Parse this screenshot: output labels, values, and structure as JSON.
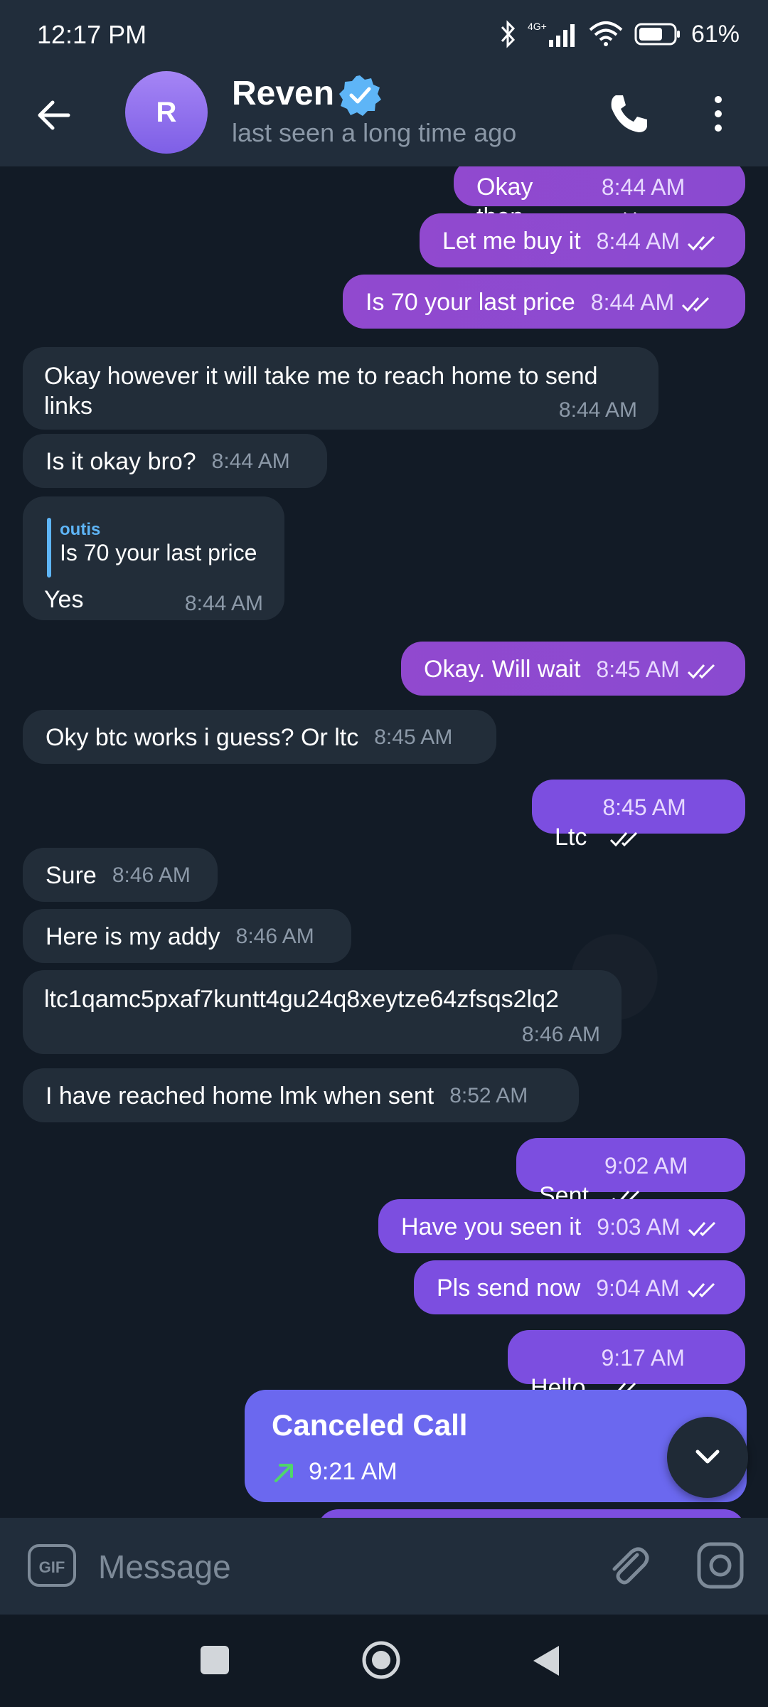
{
  "status_bar": {
    "time": "12:17 PM",
    "network": "4G+",
    "battery": "61%"
  },
  "header": {
    "avatar_letter": "R",
    "name": "Reven",
    "status": "last seen a long time ago"
  },
  "messages": [
    {
      "text": "Okay then",
      "time": "8:44 AM"
    },
    {
      "text": "Let me buy it",
      "time": "8:44 AM"
    },
    {
      "text": "Is 70 your last price",
      "time": "8:44 AM"
    },
    {
      "text": "Okay however it will take me to reach home to send links",
      "time": "8:44 AM"
    },
    {
      "text": "Is it okay bro?",
      "time": "8:44 AM"
    },
    {
      "reply_name": "outis",
      "reply_text": "Is 70 your last price",
      "text": "Yes",
      "time": "8:44 AM"
    },
    {
      "text": "Okay. Will wait",
      "time": "8:45 AM"
    },
    {
      "text": "Oky btc works i guess? Or ltc",
      "time": "8:45 AM"
    },
    {
      "text": "Ltc",
      "time": "8:45 AM"
    },
    {
      "text": "Sure",
      "time": "8:46 AM"
    },
    {
      "text": "Here is my addy",
      "time": "8:46 AM"
    },
    {
      "text": "ltc1qamc5pxaf7kuntt4gu24q8xeytze64zfsqs2lq2",
      "time": "8:46 AM"
    },
    {
      "text": "I have reached home lmk when sent",
      "time": "8:52 AM"
    },
    {
      "text": "Sent",
      "time": "9:02 AM"
    },
    {
      "text": "Have you seen it",
      "time": "9:03 AM"
    },
    {
      "text": "Pls send now",
      "time": "9:04 AM"
    },
    {
      "text": "Hello",
      "time": "9:17 AM"
    }
  ],
  "call": {
    "title": "Canceled Call",
    "time": "9:21 AM"
  },
  "input": {
    "placeholder": "Message",
    "gif_label": "GIF"
  },
  "colors": {
    "accent": "#5eb5f7",
    "outgoing": "#8e4acf",
    "incoming": "#222d39",
    "call_card": "#6b68ef"
  },
  "icons": [
    "back-arrow-icon",
    "verified-icon",
    "phone-icon",
    "more-vertical-icon",
    "double-check-icon",
    "chevron-down-icon",
    "gif-icon",
    "paperclip-icon",
    "camera-icon"
  ]
}
